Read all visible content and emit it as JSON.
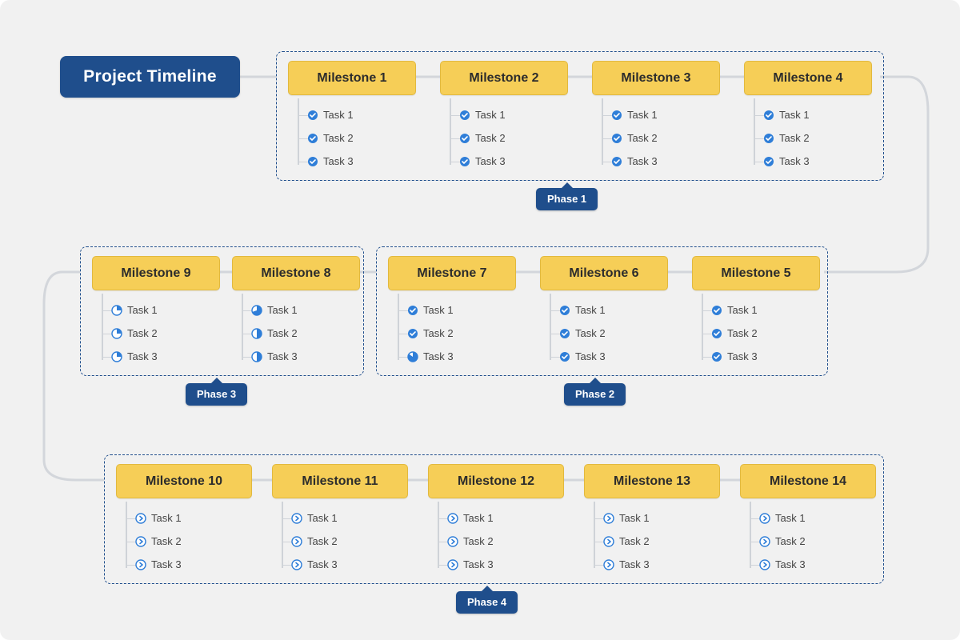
{
  "title": "Project Timeline",
  "phase1": {
    "label": "Phase 1",
    "m": [
      {
        "name": "Milestone 1",
        "t": [
          {
            "n": "Task 1",
            "s": "done"
          },
          {
            "n": "Task 2",
            "s": "done"
          },
          {
            "n": "Task 3",
            "s": "done"
          }
        ]
      },
      {
        "name": "Milestone 2",
        "t": [
          {
            "n": "Task 1",
            "s": "done"
          },
          {
            "n": "Task 2",
            "s": "done"
          },
          {
            "n": "Task 3",
            "s": "done"
          }
        ]
      },
      {
        "name": "Milestone 3",
        "t": [
          {
            "n": "Task 1",
            "s": "done"
          },
          {
            "n": "Task 2",
            "s": "done"
          },
          {
            "n": "Task 3",
            "s": "done"
          }
        ]
      },
      {
        "name": "Milestone 4",
        "t": [
          {
            "n": "Task 1",
            "s": "done"
          },
          {
            "n": "Task 2",
            "s": "done"
          },
          {
            "n": "Task 3",
            "s": "done"
          }
        ]
      }
    ]
  },
  "phase2": {
    "label": "Phase 2",
    "m": [
      {
        "name": "Milestone 7",
        "t": [
          {
            "n": "Task 1",
            "s": "done"
          },
          {
            "n": "Task 2",
            "s": "done"
          },
          {
            "n": "Task 3",
            "s": "p85"
          }
        ]
      },
      {
        "name": "Milestone 6",
        "t": [
          {
            "n": "Task 1",
            "s": "done"
          },
          {
            "n": "Task 2",
            "s": "done"
          },
          {
            "n": "Task 3",
            "s": "done"
          }
        ]
      },
      {
        "name": "Milestone 5",
        "t": [
          {
            "n": "Task 1",
            "s": "done"
          },
          {
            "n": "Task 2",
            "s": "done"
          },
          {
            "n": "Task 3",
            "s": "done"
          }
        ]
      }
    ]
  },
  "phase3": {
    "label": "Phase 3",
    "m": [
      {
        "name": "Milestone 9",
        "t": [
          {
            "n": "Task 1",
            "s": "p25"
          },
          {
            "n": "Task 2",
            "s": "p25"
          },
          {
            "n": "Task 3",
            "s": "p25"
          }
        ]
      },
      {
        "name": "Milestone 8",
        "t": [
          {
            "n": "Task 1",
            "s": "p70"
          },
          {
            "n": "Task 2",
            "s": "p50"
          },
          {
            "n": "Task 3",
            "s": "p50"
          }
        ]
      }
    ]
  },
  "phase4": {
    "label": "Phase 4",
    "m": [
      {
        "name": "Milestone 10",
        "t": [
          {
            "n": "Task 1",
            "s": "todo"
          },
          {
            "n": "Task 2",
            "s": "todo"
          },
          {
            "n": "Task 3",
            "s": "todo"
          }
        ]
      },
      {
        "name": "Milestone 11",
        "t": [
          {
            "n": "Task 1",
            "s": "todo"
          },
          {
            "n": "Task 2",
            "s": "todo"
          },
          {
            "n": "Task 3",
            "s": "todo"
          }
        ]
      },
      {
        "name": "Milestone 12",
        "t": [
          {
            "n": "Task 1",
            "s": "todo"
          },
          {
            "n": "Task 2",
            "s": "todo"
          },
          {
            "n": "Task 3",
            "s": "todo"
          }
        ]
      },
      {
        "name": "Milestone 13",
        "t": [
          {
            "n": "Task 1",
            "s": "todo"
          },
          {
            "n": "Task 2",
            "s": "todo"
          },
          {
            "n": "Task 3",
            "s": "todo"
          }
        ]
      },
      {
        "name": "Milestone 14",
        "t": [
          {
            "n": "Task 1",
            "s": "todo"
          },
          {
            "n": "Task 2",
            "s": "todo"
          },
          {
            "n": "Task 3",
            "s": "todo"
          }
        ]
      }
    ]
  }
}
